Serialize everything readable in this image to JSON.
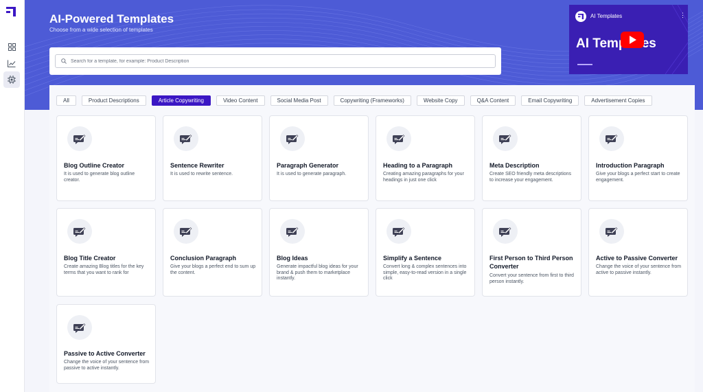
{
  "hero": {
    "title": "AI-Powered Templates",
    "subtitle": "Choose from a wide selection of templates"
  },
  "search": {
    "placeholder": "Search for a template, for example: Product Description"
  },
  "video": {
    "channel_title": "AI Templates",
    "headline": "AI Templates"
  },
  "sidebar": {
    "items": [
      {
        "icon": "dashboard-grid-icon"
      },
      {
        "icon": "analytics-chart-icon"
      },
      {
        "icon": "ai-chip-icon",
        "active": true
      }
    ]
  },
  "tabs": [
    {
      "label": "All"
    },
    {
      "label": "Product Descriptions"
    },
    {
      "label": "Article Copywriting",
      "active": true
    },
    {
      "label": "Video Content"
    },
    {
      "label": "Social Media Post"
    },
    {
      "label": "Copywriting (Frameworks)"
    },
    {
      "label": "Website Copy"
    },
    {
      "label": "Q&A Content"
    },
    {
      "label": "Email Copywriting"
    },
    {
      "label": "Advertisement Copies"
    }
  ],
  "templates": [
    {
      "title": "Blog Outline Creator",
      "description": "It is used to generate blog outline creator."
    },
    {
      "title": "Sentence Rewriter",
      "description": "It is used to rewrite sentence."
    },
    {
      "title": "Paragraph Generator",
      "description": "It is used to generate paragraph."
    },
    {
      "title": "Heading to a Paragraph",
      "description": "Creating amazing paragraphs for your headings in just one click"
    },
    {
      "title": "Meta Description",
      "description": "Create SEO friendly meta descriptions to increase your engagement."
    },
    {
      "title": "Introduction Paragraph",
      "description": "Give your blogs a perfect start to create engagement."
    },
    {
      "title": "Blog Title Creator",
      "description": "Create amazing Blog titles for the key terms that you want to rank for"
    },
    {
      "title": "Conclusion Paragraph",
      "description": "Give your blogs a perfect end to sum up the content."
    },
    {
      "title": "Blog Ideas",
      "description": "Generate impactful blog ideas for your brand & push them to marketplace instantly."
    },
    {
      "title": "Simplify a Sentence",
      "description": "Convert long & complex sentences into simple, easy-to-read version in a single click"
    },
    {
      "title": "First Person to Third Person Converter",
      "description": "Convert your sentence from first to third person instantly."
    },
    {
      "title": "Active to Passive Converter",
      "description": "Change the voice of your sentence from active to passive instantly."
    },
    {
      "title": "Passive to Active Converter",
      "description": "Change the voice of your sentence from passive to active instantly."
    }
  ],
  "colors": {
    "hero": "#4d5bd6",
    "accent": "#3b17c4",
    "video_bg": "#3a1fb3",
    "play_button": "#ff0000"
  }
}
